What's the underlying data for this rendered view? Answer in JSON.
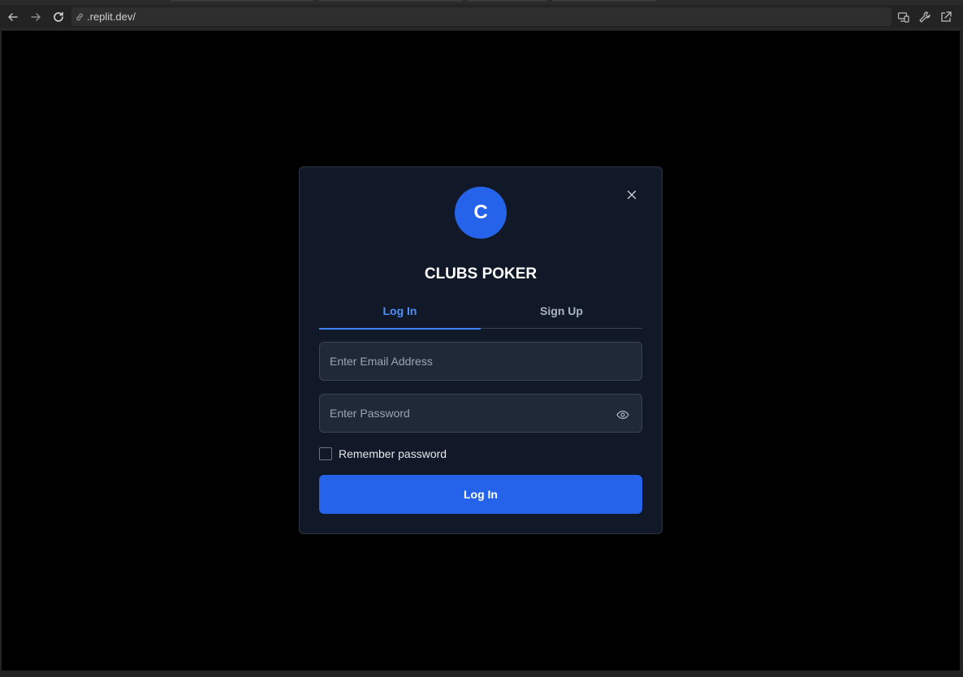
{
  "browser": {
    "url": ".replit.dev/",
    "icons": {
      "back": "arrow-left-icon",
      "forward": "arrow-right-icon",
      "reload": "reload-icon",
      "link": "link-icon",
      "devices": "devices-icon",
      "tools": "wrench-icon",
      "open_external": "external-link-icon"
    }
  },
  "modal": {
    "logo_letter": "C",
    "title": "CLUBS POKER",
    "tabs": [
      {
        "label": "Log In",
        "active": true
      },
      {
        "label": "Sign Up",
        "active": false
      }
    ],
    "email_placeholder": "Enter Email Address",
    "email_value": "",
    "password_placeholder": "Enter Password",
    "password_value": "",
    "remember_label": "Remember password",
    "remember_checked": false,
    "submit_label": "Log In"
  },
  "colors": {
    "accent": "#2563eb",
    "active_tab": "#4f8ff7",
    "modal_bg": "#111827",
    "field_bg": "#1f2937"
  }
}
